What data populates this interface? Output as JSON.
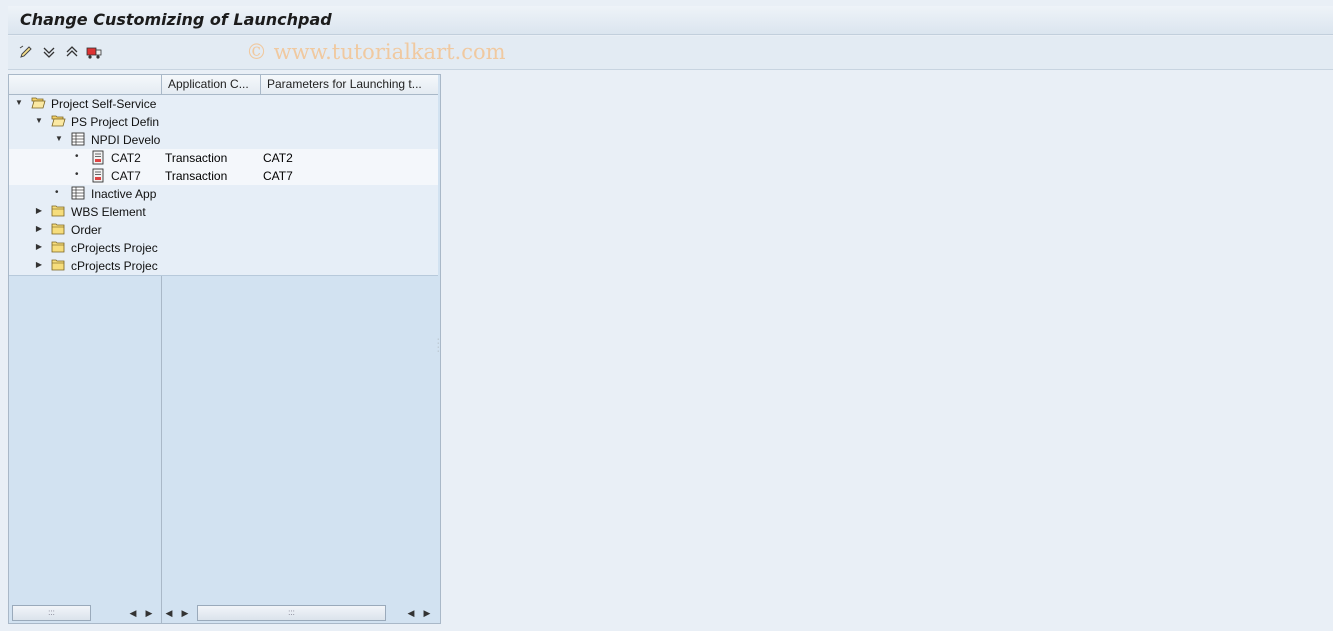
{
  "window": {
    "title": "Change Customizing of Launchpad",
    "watermark": "© www.tutorialkart.com"
  },
  "toolbar": {
    "buttons": [
      {
        "icon": "edit-pencil-icon"
      },
      {
        "icon": "expand-all-icon"
      },
      {
        "icon": "collapse-all-icon"
      },
      {
        "icon": "transport-truck-icon"
      }
    ]
  },
  "tree": {
    "columns": [
      {
        "label": ""
      },
      {
        "label": "Application C..."
      },
      {
        "label": "Parameters for Launching t..."
      }
    ],
    "rows": [
      {
        "label": "Project Self-Service",
        "icon": "folder-open-icon",
        "toggle": "expanded",
        "level": 0,
        "app_cat": "",
        "param": ""
      },
      {
        "label": "PS Project Defin",
        "icon": "folder-open-icon",
        "toggle": "expanded",
        "level": 1,
        "app_cat": "",
        "param": ""
      },
      {
        "label": "NPDI Develo",
        "icon": "table-icon",
        "toggle": "expanded",
        "level": 2,
        "app_cat": "",
        "param": ""
      },
      {
        "label": "CAT2",
        "icon": "document-icon",
        "toggle": "leaf",
        "level": 3,
        "app_cat": "Transaction",
        "param": "CAT2"
      },
      {
        "label": "CAT7",
        "icon": "document-icon",
        "toggle": "leaf",
        "level": 3,
        "app_cat": "Transaction",
        "param": "CAT7"
      },
      {
        "label": "Inactive App",
        "icon": "table-icon",
        "toggle": "leaf",
        "level": 2,
        "app_cat": "",
        "param": ""
      },
      {
        "label": "WBS Element",
        "icon": "folder-icon",
        "toggle": "collapsed",
        "level": 1,
        "app_cat": "",
        "param": ""
      },
      {
        "label": "Order",
        "icon": "folder-icon",
        "toggle": "collapsed",
        "level": 1,
        "app_cat": "",
        "param": ""
      },
      {
        "label": "cProjects Projec",
        "icon": "folder-icon",
        "toggle": "collapsed",
        "level": 1,
        "app_cat": "",
        "param": ""
      },
      {
        "label": "cProjects Projec",
        "icon": "folder-icon",
        "toggle": "collapsed",
        "level": 1,
        "app_cat": "",
        "param": ""
      }
    ]
  },
  "colors": {
    "background": "#e9eff6",
    "tree_background": "#d2e2f1",
    "title_text": "#1c1c1c",
    "watermark": "#f0c9a0"
  }
}
